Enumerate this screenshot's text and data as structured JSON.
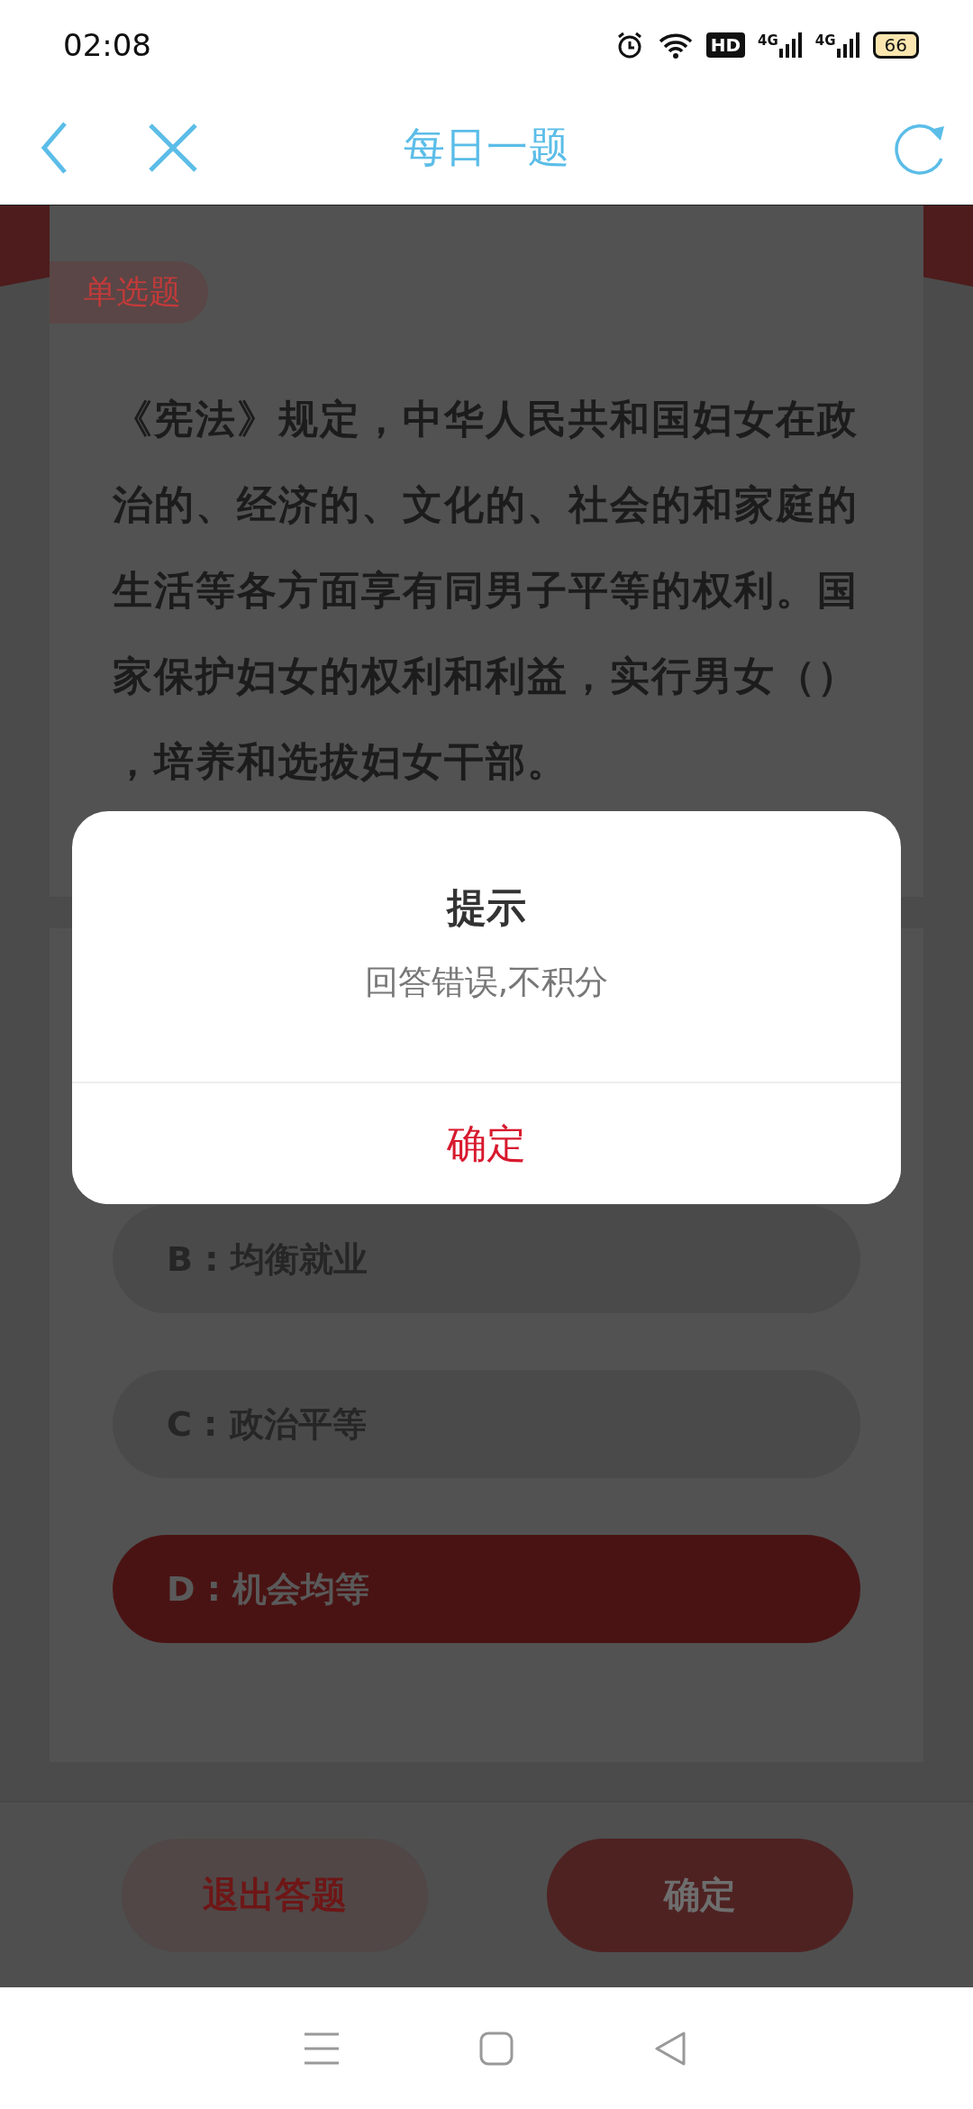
{
  "status_bar": {
    "time": "02:08",
    "network_labels": [
      "4G",
      "4G"
    ],
    "hd": "HD",
    "battery": "66"
  },
  "header": {
    "title": "每日一题"
  },
  "question": {
    "type_tag": "单选题",
    "text": "《宪法》规定，中华人民共和国妇女在政治的、经济的、文化的、社会的和家庭的生活等各方面享有同男子平等的权利。国家保护妇女的权利和利益，实行男女（），培养和选拔妇女干部。"
  },
  "options": [
    {
      "label": "B : 均衡就业",
      "selected": false
    },
    {
      "label": "C : 政治平等",
      "selected": false
    },
    {
      "label": "D : 机会均等",
      "selected": true
    }
  ],
  "buttons": {
    "exit": "退出答题",
    "confirm": "确定"
  },
  "dialog": {
    "title": "提示",
    "message": "回答错误,不积分",
    "button": "确定"
  }
}
